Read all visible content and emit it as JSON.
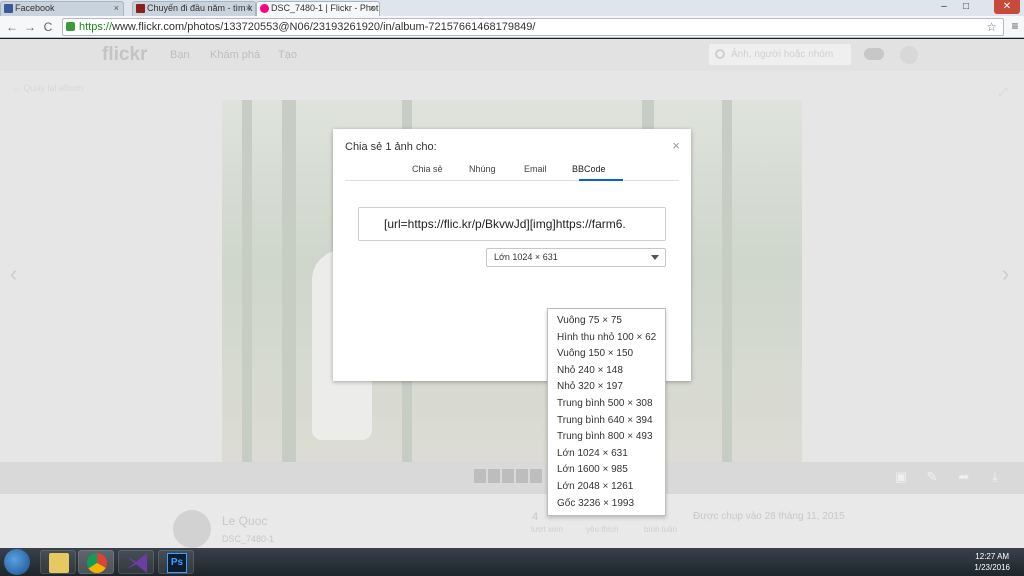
{
  "browser": {
    "tabs": [
      {
        "title": "Facebook",
        "favicon_color": "#3b5998"
      },
      {
        "title": "Chuyến đi đầu năm - tìm k",
        "favicon_color": "#8b1f1f"
      },
      {
        "title": "DSC_7480-1 | Flickr - Phot",
        "favicon_color": "#ff0084"
      }
    ],
    "close_glyph": "×",
    "url_scheme": "https://",
    "url_rest": "www.flickr.com/photos/133720553@N06/23193261920/in/album-72157661468179849/",
    "star_glyph": "☆",
    "menu_glyph": "≡",
    "back_glyph": "←",
    "forward_glyph": "→",
    "reload_glyph": "C",
    "win_min": "–",
    "win_max": "□",
    "win_close": "✕"
  },
  "flickr": {
    "logo": "flickr",
    "nav": [
      "Bạn",
      "Khám phá",
      "Tạo"
    ],
    "search_placeholder": "Ảnh, người hoặc nhóm",
    "back_to_album": "← Quay lại album",
    "expand_glyph": "⤢",
    "prev_glyph": "‹",
    "next_glyph": "›",
    "toolbar_icons": [
      "▣",
      "✎",
      "➦",
      "⤓"
    ]
  },
  "photo_info": {
    "owner": "Le Quoc",
    "photo_title": "DSC_7480-1",
    "stats": [
      {
        "value": "4",
        "label": "lượt xem"
      },
      {
        "value": "",
        "label": "yêu thích"
      },
      {
        "value": "",
        "label": "bình luận"
      }
    ],
    "taken": "Được chụp vào 28 tháng 11, 2015"
  },
  "share_modal": {
    "title": "Chia sẻ 1 ảnh cho:",
    "close": "×",
    "tabs": [
      "Chia sẻ",
      "Nhúng",
      "Email",
      "BBCode"
    ],
    "active_tab": "BBCode",
    "bbcode": "[url=https://flic.kr/p/BkvwJd][img]https://farm6.",
    "selected_size": "Lớn 1024 × 631",
    "size_options": [
      "Vuông 75 × 75",
      "Hình thu nhỏ 100 × 62",
      "Vuông 150 × 150",
      "Nhỏ 240 × 148",
      "Nhỏ 320 × 197",
      "Trung bình 500 × 308",
      "Trung bình 640 × 394",
      "Trung bình 800 × 493",
      "Lớn 1024 × 631",
      "Lớn 1600 × 985",
      "Lớn 2048 × 1261",
      "Gốc 3236 × 1993"
    ]
  },
  "taskbar": {
    "time": "12:27 AM",
    "date": "1/23/2016",
    "ps_label": "Ps"
  }
}
